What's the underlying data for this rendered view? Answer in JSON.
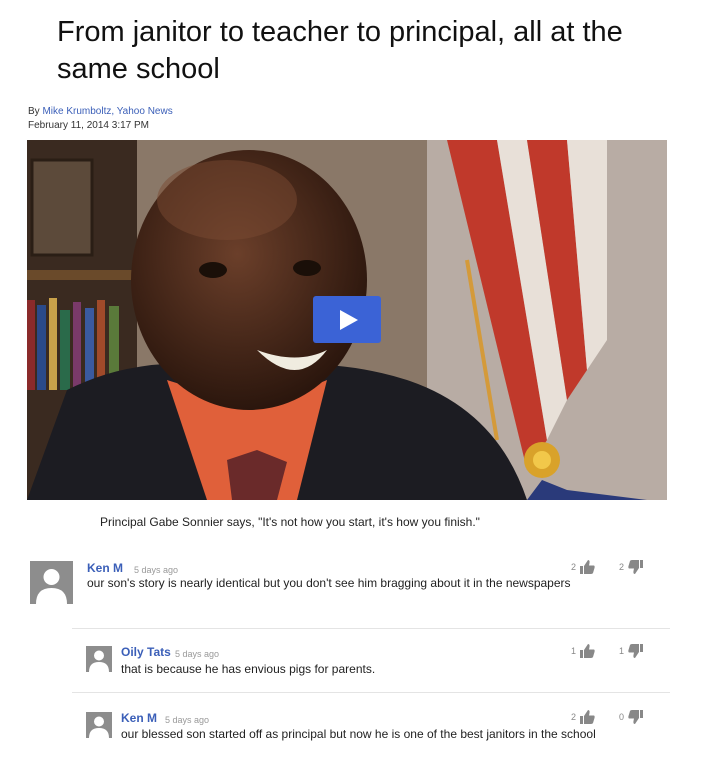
{
  "article": {
    "headline": "From janitor to teacher to principal, all at the same school",
    "byline_prefix": "By ",
    "author": "Mike Krumboltz, Yahoo News",
    "date": "February 11, 2014 3:17 PM",
    "caption": "Principal Gabe Sonnier says, \"It's not how you start, it's how you finish.\""
  },
  "comments": [
    {
      "name": "Ken M",
      "time": "5 days ago",
      "text": "our son's story is nearly identical but you don't see him bragging about it in the newspapers",
      "likes": "2",
      "dislikes": "2"
    },
    {
      "name": "Oily Tats",
      "time": "5 days ago",
      "text": "that is because he has envious pigs for parents.",
      "likes": "1",
      "dislikes": "1"
    },
    {
      "name": "Ken M",
      "time": "5 days ago",
      "text": "our blessed son started off as principal but now he is one of the best janitors in the school",
      "likes": "2",
      "dislikes": "0"
    }
  ]
}
